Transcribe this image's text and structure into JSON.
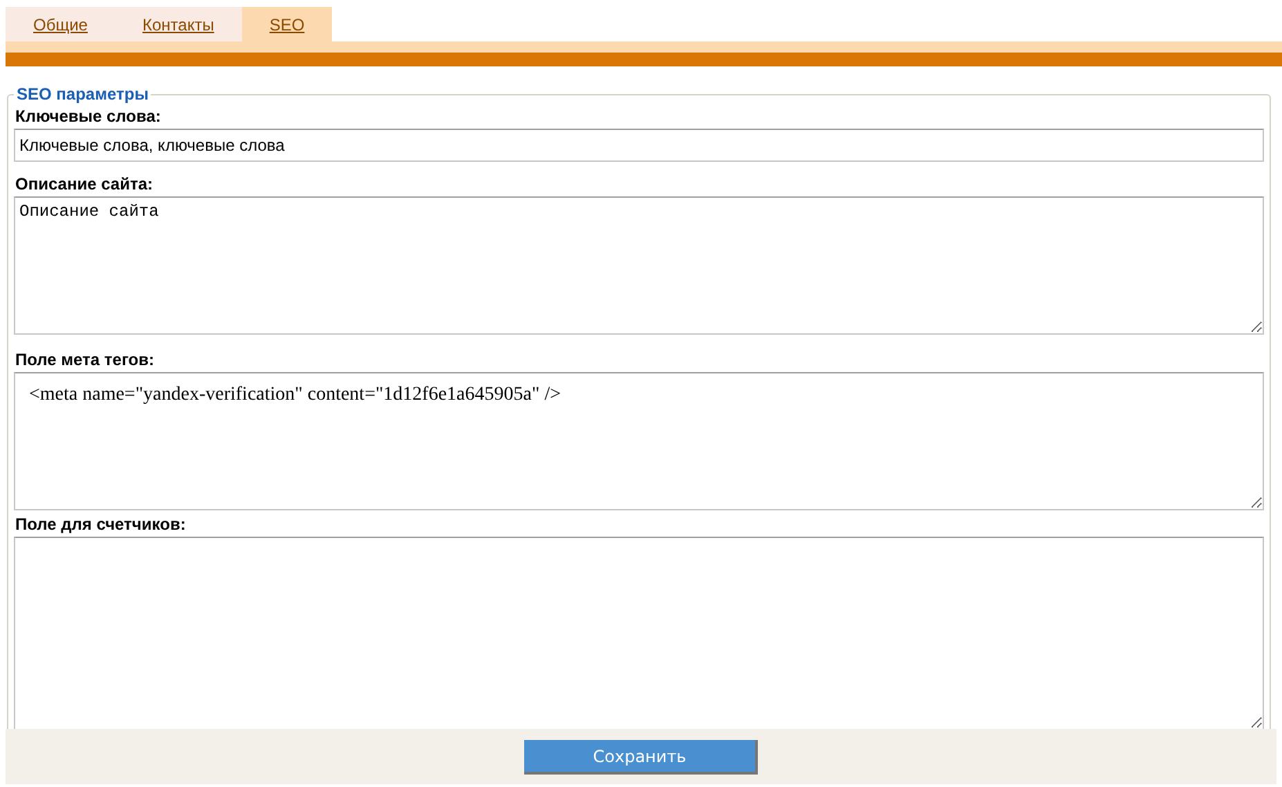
{
  "tabs": [
    {
      "label": "Общие",
      "selected": false
    },
    {
      "label": "Контакты",
      "selected": false
    },
    {
      "label": "SEO",
      "selected": true
    }
  ],
  "fieldset": {
    "legend": "SEO параметры",
    "fields": [
      {
        "kind": "input",
        "label": "Ключевые слова:",
        "value": "Ключевые слова, ключевые слова"
      },
      {
        "kind": "textarea",
        "label": "Описание сайта:",
        "value": "Описание сайта"
      },
      {
        "kind": "html",
        "label": "Поле мета тегов:",
        "value": "<meta name=\"yandex-verification\" content=\"1d12f6e1a645905a\" />"
      },
      {
        "kind": "html",
        "label": "Поле для счетчиков:"
      }
    ]
  },
  "save_button": "Сохранить"
}
